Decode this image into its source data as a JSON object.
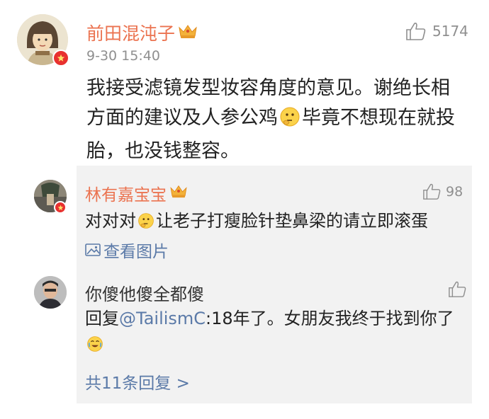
{
  "main_comment": {
    "username": "前田混沌子",
    "timestamp": "9-30 15:40",
    "like_count": "5174",
    "text_part1": "我接受滤镜发型妆容角度的意见。谢绝长相方面的建议及人参公鸡",
    "text_part2": "毕竟不想现在就投胎，也没钱整容。",
    "emoji": "thinking-emoji",
    "verified_badge": "red-v-badge",
    "member_icon": "crown-icon"
  },
  "replies": [
    {
      "username": "林有嘉宝宝",
      "like_count": "98",
      "text_part1": "对对对",
      "text_part2": "让老子打瘦脸针垫鼻梁的请立即滚蛋",
      "view_picture_label": "查看图片",
      "emoji": "thinking-emoji",
      "member_icon": "crown-icon"
    },
    {
      "username": "你傻他傻全都傻",
      "like_count": "",
      "reply_prefix": "回复",
      "mention": "@TailismC",
      "text": ":18年了。女朋友我终于找到你了",
      "emoji": "crying-laughing-emoji"
    }
  ],
  "more_replies_label": "共11条回复 >",
  "colors": {
    "username": "#eb7350",
    "link": "#5b7aa8",
    "muted": "#8f8f8f",
    "reply_bg": "#f2f2f2",
    "badge": "#e8312f"
  }
}
